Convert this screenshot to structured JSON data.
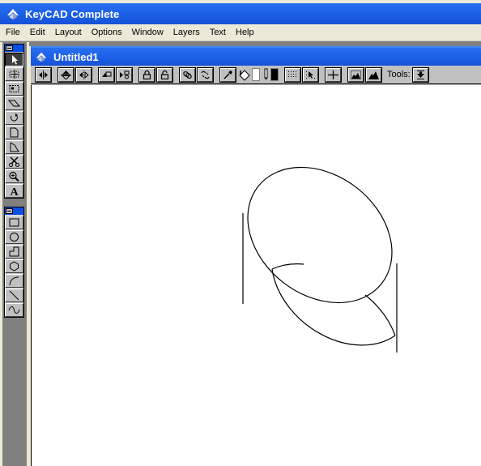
{
  "app": {
    "title": "KeyCAD Complete",
    "icon": "keycad-logo-icon",
    "title_bar_color": "#1a5ee6",
    "menu_bar_color": "#ece9d8"
  },
  "menu": {
    "items": [
      "File",
      "Edit",
      "Layout",
      "Options",
      "Window",
      "Layers",
      "Text",
      "Help"
    ]
  },
  "document": {
    "title": "Untitled1",
    "icon": "keycad-doc-icon"
  },
  "toolbar": {
    "buttons": [
      {
        "name": "flip-horizontal",
        "icon": "flip-horizontal-icon"
      },
      {
        "name": "flip-vertical",
        "icon": "flip-vertical-icon"
      },
      {
        "name": "mirror",
        "icon": "mirror-icon"
      },
      {
        "name": "bring-front",
        "icon": "bring-to-front-icon"
      },
      {
        "name": "send-back",
        "icon": "send-to-back-icon"
      },
      {
        "name": "lock",
        "icon": "lock-icon"
      },
      {
        "name": "unlock",
        "icon": "unlock-icon"
      },
      {
        "name": "group",
        "icon": "group-link-icon"
      },
      {
        "name": "ungroup",
        "icon": "ungroup-link-icon"
      },
      {
        "name": "eyedropper",
        "icon": "eyedropper-icon"
      },
      {
        "name": "fill",
        "icon": "paint-bucket-icon"
      },
      {
        "name": "pen",
        "icon": "pen-icon"
      },
      {
        "name": "grid",
        "icon": "grid-icon"
      },
      {
        "name": "snap",
        "icon": "snap-pointer-icon"
      },
      {
        "name": "crosshair",
        "icon": "crosshair-icon"
      },
      {
        "name": "landscape-outline",
        "icon": "landscape-outline-icon"
      },
      {
        "name": "landscape-filled",
        "icon": "landscape-filled-icon"
      }
    ],
    "fill_color": "#ffffff",
    "pen_color": "#000000",
    "tools_label": "Tools:",
    "tools_dropdown_icon": "download-arrow-icon"
  },
  "palette_select": {
    "tools": [
      {
        "name": "pointer",
        "icon": "pointer-arrow-icon",
        "active": true
      },
      {
        "name": "marquee-crosshair",
        "icon": "marquee-crosshair-icon",
        "active": false
      },
      {
        "name": "marquee-box",
        "icon": "marquee-box-icon",
        "active": false
      },
      {
        "name": "skew",
        "icon": "skew-parallelogram-icon",
        "active": false
      },
      {
        "name": "rotate",
        "icon": "rotate-icon",
        "active": false
      },
      {
        "name": "reshape",
        "icon": "reshape-icon",
        "active": false
      },
      {
        "name": "reshape-node",
        "icon": "reshape-node-icon",
        "active": false
      },
      {
        "name": "scissors",
        "icon": "scissors-icon",
        "active": false
      },
      {
        "name": "zoom",
        "icon": "magnifier-icon",
        "active": false
      },
      {
        "name": "text",
        "icon": "text-a-icon",
        "active": false
      }
    ]
  },
  "palette_draw": {
    "tools": [
      {
        "name": "rectangle",
        "icon": "rectangle-icon"
      },
      {
        "name": "circle",
        "icon": "circle-icon"
      },
      {
        "name": "polyline",
        "icon": "polyline-step-icon"
      },
      {
        "name": "polygon",
        "icon": "hexagon-icon"
      },
      {
        "name": "arc",
        "icon": "arc-icon"
      },
      {
        "name": "line",
        "icon": "line-icon"
      },
      {
        "name": "freehand",
        "icon": "sine-curve-icon"
      }
    ]
  },
  "drawing": {
    "shape": "cylinder",
    "description": "Wireframe cylinder with tilted elliptical top and bottom faces"
  }
}
